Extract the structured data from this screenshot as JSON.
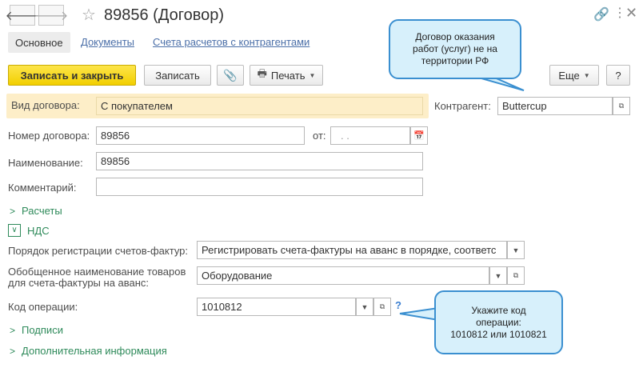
{
  "window": {
    "title": "89856 (Договор)",
    "icons": [
      "arrow-left-icon",
      "arrow-right-icon",
      "star-icon",
      "link-icon",
      "more-icon",
      "close-icon"
    ]
  },
  "tabs": [
    {
      "label": "Основное",
      "active": true
    },
    {
      "label": "Документы",
      "active": false
    },
    {
      "label": "Счета расчетов с контрагентами",
      "active": false
    }
  ],
  "toolbar": {
    "save_close": "Записать и закрыть",
    "save": "Записать",
    "print": "Печать",
    "more": "Еще",
    "help": "?"
  },
  "form": {
    "contract_type_label": "Вид договора:",
    "contract_type_value": "С покупателем",
    "counterparty_label": "Контрагент:",
    "counterparty_value": "Buttercup",
    "number_label": "Номер договора:",
    "number_value": "89856",
    "date_label": "от:",
    "date_value": ". .",
    "name_label": "Наименование:",
    "name_value": "89856",
    "comment_label": "Комментарий:",
    "comment_value": ""
  },
  "groups": {
    "payments": "Расчеты",
    "vat": "НДС",
    "signatures": "Подписи",
    "additional": "Дополнительная информация"
  },
  "vat": {
    "invoice_order_label": "Порядок регистрации счетов-фактур:",
    "invoice_order_value": "Регистрировать счета-фактуры на аванс в порядке, соответс",
    "goods_name_label_1": "Обобщенное наименование товаров",
    "goods_name_label_2": "для счета-фактуры на аванс:",
    "goods_name_value": "Оборудование",
    "op_code_label": "Код операции:",
    "op_code_value": "1010812",
    "op_code_help": "?"
  },
  "callouts": {
    "top_1": "Договор оказания",
    "top_2": "работ (услуг) не на",
    "top_3": "территории РФ",
    "bottom_1": "Укажите код",
    "bottom_2": "операции:",
    "bottom_3": "1010812 или 1010821"
  },
  "colors": {
    "primary_button": "#f2cf00",
    "highlight_row": "#fdeec8",
    "link": "#4b6fa8",
    "group_green": "#2e8a5a",
    "bubble_fill": "#d7f0fb",
    "bubble_border": "#3a8fd0"
  }
}
